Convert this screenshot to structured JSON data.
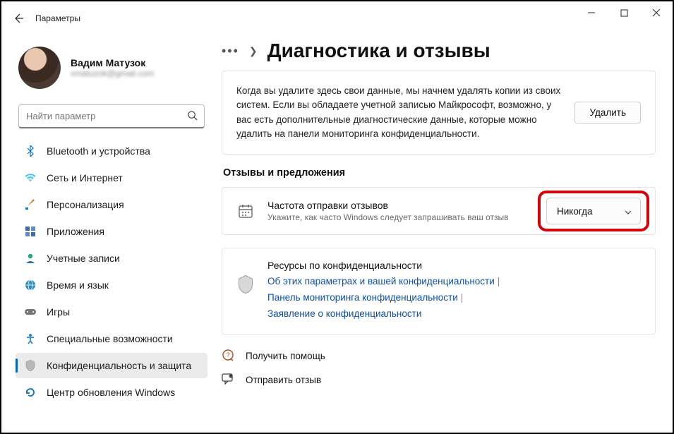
{
  "app_title": "Параметры",
  "profile": {
    "name": "Вадим Матузок",
    "email": "vmatuzok@gmail.com"
  },
  "search": {
    "placeholder": "Найти параметр"
  },
  "nav": [
    {
      "label": "Bluetooth и устройства",
      "icon": "bluetooth"
    },
    {
      "label": "Сеть и Интернет",
      "icon": "wifi"
    },
    {
      "label": "Персонализация",
      "icon": "brush"
    },
    {
      "label": "Приложения",
      "icon": "apps"
    },
    {
      "label": "Учетные записи",
      "icon": "account"
    },
    {
      "label": "Время и язык",
      "icon": "globe"
    },
    {
      "label": "Игры",
      "icon": "gamepad"
    },
    {
      "label": "Специальные возможности",
      "icon": "accessibility"
    },
    {
      "label": "Конфиденциальность и защита",
      "icon": "shield",
      "selected": true
    },
    {
      "label": "Центр обновления Windows",
      "icon": "update"
    }
  ],
  "page_title": "Диагностика и отзывы",
  "delete_card": {
    "text": "Когда вы удалите здесь свои данные, мы начнем удалять копии из своих систем. Если вы обладаете учетной записью Майкрософт, возможно, у вас есть дополнительные диагностические данные, которые можно удалить на панели мониторинга конфиденциальности.",
    "button": "Удалить"
  },
  "feedback_section_title": "Отзывы и предложения",
  "frequency": {
    "title": "Частота отправки отзывов",
    "subtitle": "Укажите, как часто Windows следует запрашивать ваш отзыв",
    "value": "Никогда"
  },
  "resources": {
    "title": "Ресурсы по конфиденциальности",
    "links": [
      "Об этих параметрах и вашей конфиденциальности",
      "Панель мониторинга конфиденциальности",
      "Заявление о конфиденциальности"
    ]
  },
  "help": {
    "get_help": "Получить помощь",
    "feedback": "Отправить отзыв"
  }
}
